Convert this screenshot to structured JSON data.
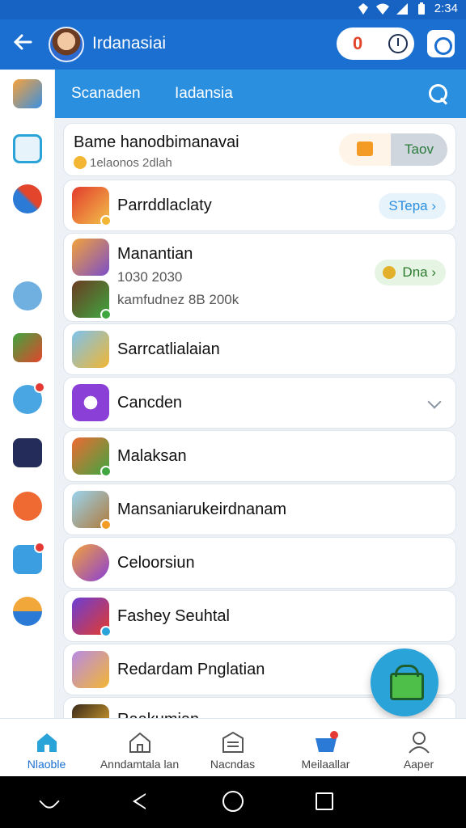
{
  "status_bar": {
    "time": "2:34"
  },
  "app_bar": {
    "title": "Irdanasiai",
    "pill_count": "0"
  },
  "tabs": [
    "Scanaden",
    "Iadansia"
  ],
  "featured": {
    "title": "Bame hanodbimanavai",
    "subtitle": "1elaonos 2dlah",
    "segment_label": "Taov"
  },
  "rows": [
    {
      "title": "Parrddlaclaty",
      "action": "STepa"
    },
    {
      "title": "Manantian",
      "line2": "1030 2030",
      "line3": "kamfudnez 8B 200k",
      "action": "Dna"
    },
    {
      "title": "Sarrcatlialaian"
    },
    {
      "title": "Cancden"
    },
    {
      "title": "Malaksan"
    },
    {
      "title": "Mansaniarukeirdnanam"
    },
    {
      "title": "Celoorsiun"
    },
    {
      "title": "Fashey Seuhtal"
    },
    {
      "title": "Redardam Pnglatian"
    },
    {
      "title": "Raakumian"
    }
  ],
  "bottom_nav": [
    {
      "label": "Nlaoble",
      "active": true
    },
    {
      "label": "Anndamtala lan",
      "active": false
    },
    {
      "label": "Nacndas",
      "active": false
    },
    {
      "label": "Meilaallar",
      "active": false
    },
    {
      "label": "Aaper",
      "active": false
    }
  ],
  "icons": {
    "rail": [
      "fish-icon",
      "list-icon",
      "tools-icon",
      "cat-icon",
      "hammer-icon",
      "heart-badge-icon",
      "grid-icon",
      "monster-icon",
      "heart-badge-icon",
      "character-icon"
    ],
    "bottom_nav": [
      "home-icon",
      "house-outline-icon",
      "inbox-icon",
      "cart-basket-icon",
      "person-icon"
    ]
  },
  "colors": {
    "app_bar": "#1b6fd0",
    "tab_strip": "#2b8fdf",
    "accent": "#1b6fd0",
    "fab": "#2aa3d9"
  }
}
